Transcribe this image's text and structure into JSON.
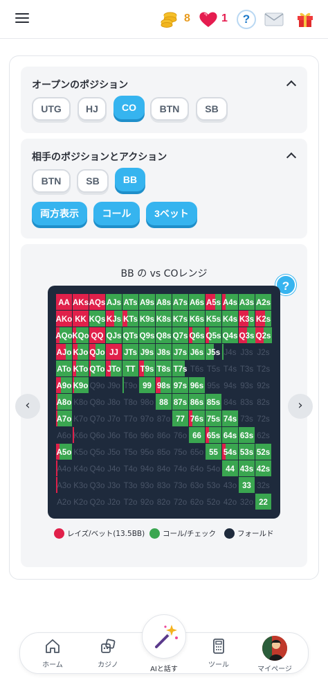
{
  "header": {
    "menu_icon": "hamburger-menu-icon",
    "coins": "8",
    "hearts": "1",
    "help_label": "?",
    "colors": {
      "coins": "#e89a1c",
      "hearts": "#e51c4f",
      "accent": "#36b4ef"
    }
  },
  "open_position": {
    "title": "オープンのポジション",
    "options": [
      "UTG",
      "HJ",
      "CO",
      "BTN",
      "SB"
    ],
    "selected": "CO"
  },
  "opponent": {
    "title": "相手のポジションとアクション",
    "positions": [
      "BTN",
      "SB",
      "BB"
    ],
    "selected": "BB",
    "actions": [
      "両方表示",
      "コール",
      "3ベット"
    ]
  },
  "range": {
    "title": "BB の vs COレンジ",
    "help_label": "?",
    "prev_label": "‹",
    "next_label": "›"
  },
  "chart_data": {
    "type": "heatmap",
    "title": "BB の vs COレンジ",
    "ranks": [
      "A",
      "K",
      "Q",
      "J",
      "T",
      "9",
      "8",
      "7",
      "6",
      "5",
      "4",
      "3",
      "2"
    ],
    "cell_mix_note": "each cell: [raise fraction, call fraction]; remainder is fold",
    "rows": [
      [
        "AA",
        "AKs",
        "AQs",
        "AJs",
        "ATs",
        "A9s",
        "A8s",
        "A7s",
        "A6s",
        "A5s",
        "A4s",
        "A3s",
        "A2s"
      ],
      [
        "AKo",
        "KK",
        "KQs",
        "KJs",
        "KTs",
        "K9s",
        "K8s",
        "K7s",
        "K6s",
        "K5s",
        "K4s",
        "K3s",
        "K2s"
      ],
      [
        "AQo",
        "KQo",
        "QQ",
        "QJs",
        "QTs",
        "Q9s",
        "Q8s",
        "Q7s",
        "Q6s",
        "Q5s",
        "Q4s",
        "Q3s",
        "Q2s"
      ],
      [
        "AJo",
        "KJo",
        "QJo",
        "JJ",
        "JTs",
        "J9s",
        "J8s",
        "J7s",
        "J6s",
        "J5s",
        "J4s",
        "J3s",
        "J2s"
      ],
      [
        "ATo",
        "KTo",
        "QTo",
        "JTo",
        "TT",
        "T9s",
        "T8s",
        "T7s",
        "T6s",
        "T5s",
        "T4s",
        "T3s",
        "T2s"
      ],
      [
        "A9o",
        "K9o",
        "Q9o",
        "J9o",
        "T9o",
        "99",
        "98s",
        "97s",
        "96s",
        "95s",
        "94s",
        "93s",
        "92s"
      ],
      [
        "A8o",
        "K8o",
        "Q8o",
        "J8o",
        "T8o",
        "98o",
        "88",
        "87s",
        "86s",
        "85s",
        "84s",
        "83s",
        "82s"
      ],
      [
        "A7o",
        "K7o",
        "Q7o",
        "J7o",
        "T7o",
        "97o",
        "87o",
        "77",
        "76s",
        "75s",
        "74s",
        "73s",
        "72s"
      ],
      [
        "A6o",
        "K6o",
        "Q6o",
        "J6o",
        "T6o",
        "96o",
        "86o",
        "76o",
        "66",
        "65s",
        "64s",
        "63s",
        "62s"
      ],
      [
        "A5o",
        "K5o",
        "Q5o",
        "J5o",
        "T5o",
        "95o",
        "85o",
        "75o",
        "65o",
        "55",
        "54s",
        "53s",
        "52s"
      ],
      [
        "A4o",
        "K4o",
        "Q4o",
        "J4o",
        "T4o",
        "94o",
        "84o",
        "74o",
        "64o",
        "54o",
        "44",
        "43s",
        "42s"
      ],
      [
        "A3o",
        "K3o",
        "Q3o",
        "J3o",
        "T3o",
        "93o",
        "83o",
        "73o",
        "63o",
        "53o",
        "43o",
        "33",
        "32s"
      ],
      [
        "A2o",
        "K2o",
        "Q2o",
        "J2o",
        "T2o",
        "92o",
        "82o",
        "72o",
        "62o",
        "52o",
        "42o",
        "32o",
        "22"
      ]
    ],
    "mix": [
      [
        [
          1,
          0
        ],
        [
          1,
          0
        ],
        [
          1,
          0
        ],
        [
          0,
          1
        ],
        [
          0,
          1
        ],
        [
          0,
          1
        ],
        [
          0,
          1
        ],
        [
          0,
          1
        ],
        [
          0,
          1
        ],
        [
          0.6,
          0.4
        ],
        [
          0.2,
          0.8
        ],
        [
          0,
          1
        ],
        [
          0,
          1
        ]
      ],
      [
        [
          1,
          0
        ],
        [
          1,
          0
        ],
        [
          0,
          1
        ],
        [
          0.5,
          0.5
        ],
        [
          0.3,
          0.7
        ],
        [
          0,
          1
        ],
        [
          0,
          1
        ],
        [
          0,
          1
        ],
        [
          0,
          1
        ],
        [
          0,
          1
        ],
        [
          0,
          1
        ],
        [
          0.6,
          0.4
        ],
        [
          0.6,
          0.4
        ]
      ],
      [
        [
          0.2,
          0.8
        ],
        [
          0.2,
          0.8
        ],
        [
          1,
          0
        ],
        [
          0,
          1
        ],
        [
          0,
          1
        ],
        [
          0,
          1
        ],
        [
          0,
          1
        ],
        [
          0,
          1
        ],
        [
          0.2,
          0.8
        ],
        [
          0.2,
          0.8
        ],
        [
          0,
          1
        ],
        [
          0.5,
          0.5
        ],
        [
          0.5,
          0.5
        ]
      ],
      [
        [
          0.6,
          0.4
        ],
        [
          0.3,
          0.7
        ],
        [
          0.4,
          0.6
        ],
        [
          1,
          0
        ],
        [
          0,
          1
        ],
        [
          0,
          1
        ],
        [
          0,
          1
        ],
        [
          0,
          1
        ],
        [
          0,
          1
        ],
        [
          0,
          0.5
        ],
        [
          0,
          0.1
        ],
        [
          0,
          0
        ],
        [
          0,
          0
        ]
      ],
      [
        [
          0,
          1
        ],
        [
          0.2,
          0.8
        ],
        [
          0.1,
          0.9
        ],
        [
          0.3,
          0.7
        ],
        [
          0,
          1
        ],
        [
          0.3,
          0.7
        ],
        [
          0,
          1
        ],
        [
          0,
          0.8
        ],
        [
          0,
          0
        ],
        [
          0,
          0
        ],
        [
          0,
          0
        ],
        [
          0,
          0
        ],
        [
          0,
          0
        ]
      ],
      [
        [
          0.3,
          0.7
        ],
        [
          0.1,
          0.9
        ],
        [
          0,
          0
        ],
        [
          0,
          0
        ],
        [
          0,
          0.1
        ],
        [
          0,
          1
        ],
        [
          0.3,
          0.7
        ],
        [
          0,
          1
        ],
        [
          0,
          1
        ],
        [
          0,
          0
        ],
        [
          0,
          0
        ],
        [
          0,
          0
        ],
        [
          0,
          0
        ]
      ],
      [
        [
          0.1,
          0.9
        ],
        [
          0,
          0
        ],
        [
          0,
          0
        ],
        [
          0,
          0
        ],
        [
          0,
          0
        ],
        [
          0,
          0
        ],
        [
          0,
          1
        ],
        [
          0,
          1
        ],
        [
          0,
          1
        ],
        [
          0,
          1
        ],
        [
          0,
          0
        ],
        [
          0,
          0
        ],
        [
          0,
          0
        ]
      ],
      [
        [
          0.1,
          0.9
        ],
        [
          0,
          0
        ],
        [
          0,
          0
        ],
        [
          0,
          0
        ],
        [
          0,
          0
        ],
        [
          0,
          0
        ],
        [
          0,
          0
        ],
        [
          0,
          1
        ],
        [
          0.2,
          0.8
        ],
        [
          0,
          1
        ],
        [
          0,
          1
        ],
        [
          0,
          0
        ],
        [
          0,
          0
        ]
      ],
      [
        [
          0,
          0
        ],
        [
          0.1,
          0
        ],
        [
          0,
          0
        ],
        [
          0,
          0
        ],
        [
          0,
          0
        ],
        [
          0,
          0
        ],
        [
          0,
          0
        ],
        [
          0,
          0
        ],
        [
          0,
          1
        ],
        [
          0.2,
          0.8
        ],
        [
          0,
          1
        ],
        [
          0,
          1
        ],
        [
          0,
          0
        ]
      ],
      [
        [
          0.2,
          0.8
        ],
        [
          0,
          0
        ],
        [
          0,
          0
        ],
        [
          0,
          0
        ],
        [
          0,
          0
        ],
        [
          0,
          0
        ],
        [
          0,
          0
        ],
        [
          0,
          0
        ],
        [
          0,
          0
        ],
        [
          0,
          1
        ],
        [
          0.2,
          0.8
        ],
        [
          0,
          1
        ],
        [
          0,
          1
        ]
      ],
      [
        [
          0.1,
          0
        ],
        [
          0,
          0
        ],
        [
          0,
          0
        ],
        [
          0,
          0
        ],
        [
          0,
          0
        ],
        [
          0,
          0
        ],
        [
          0,
          0
        ],
        [
          0,
          0
        ],
        [
          0,
          0
        ],
        [
          0,
          0
        ],
        [
          0,
          1
        ],
        [
          0,
          1
        ],
        [
          0,
          1
        ]
      ],
      [
        [
          0.1,
          0
        ],
        [
          0,
          0
        ],
        [
          0,
          0
        ],
        [
          0,
          0
        ],
        [
          0,
          0
        ],
        [
          0,
          0
        ],
        [
          0,
          0
        ],
        [
          0,
          0
        ],
        [
          0,
          0
        ],
        [
          0,
          0
        ],
        [
          0,
          0
        ],
        [
          0,
          1
        ],
        [
          0,
          0
        ]
      ],
      [
        [
          0,
          0
        ],
        [
          0,
          0
        ],
        [
          0,
          0
        ],
        [
          0,
          0
        ],
        [
          0,
          0
        ],
        [
          0,
          0
        ],
        [
          0,
          0
        ],
        [
          0,
          0
        ],
        [
          0,
          0
        ],
        [
          0,
          0
        ],
        [
          0,
          0
        ],
        [
          0,
          0
        ],
        [
          0,
          1
        ]
      ]
    ],
    "colors": {
      "raise": "#e0204a",
      "call": "#3aa650",
      "fold": "#1e2a3c",
      "fold_text": "#4a5568"
    },
    "legend": [
      "レイズ/ベット(13.5BB)",
      "コール/チェック",
      "フォールド"
    ]
  },
  "bottom_nav": {
    "items": [
      {
        "label": "ホーム",
        "icon": "home-icon"
      },
      {
        "label": "カジノ",
        "icon": "dice-icon"
      },
      {
        "label": "AIと話す",
        "icon": "magic-wand-icon"
      },
      {
        "label": "ツール",
        "icon": "calculator-icon"
      },
      {
        "label": "マイページ",
        "icon": "avatar"
      }
    ]
  }
}
